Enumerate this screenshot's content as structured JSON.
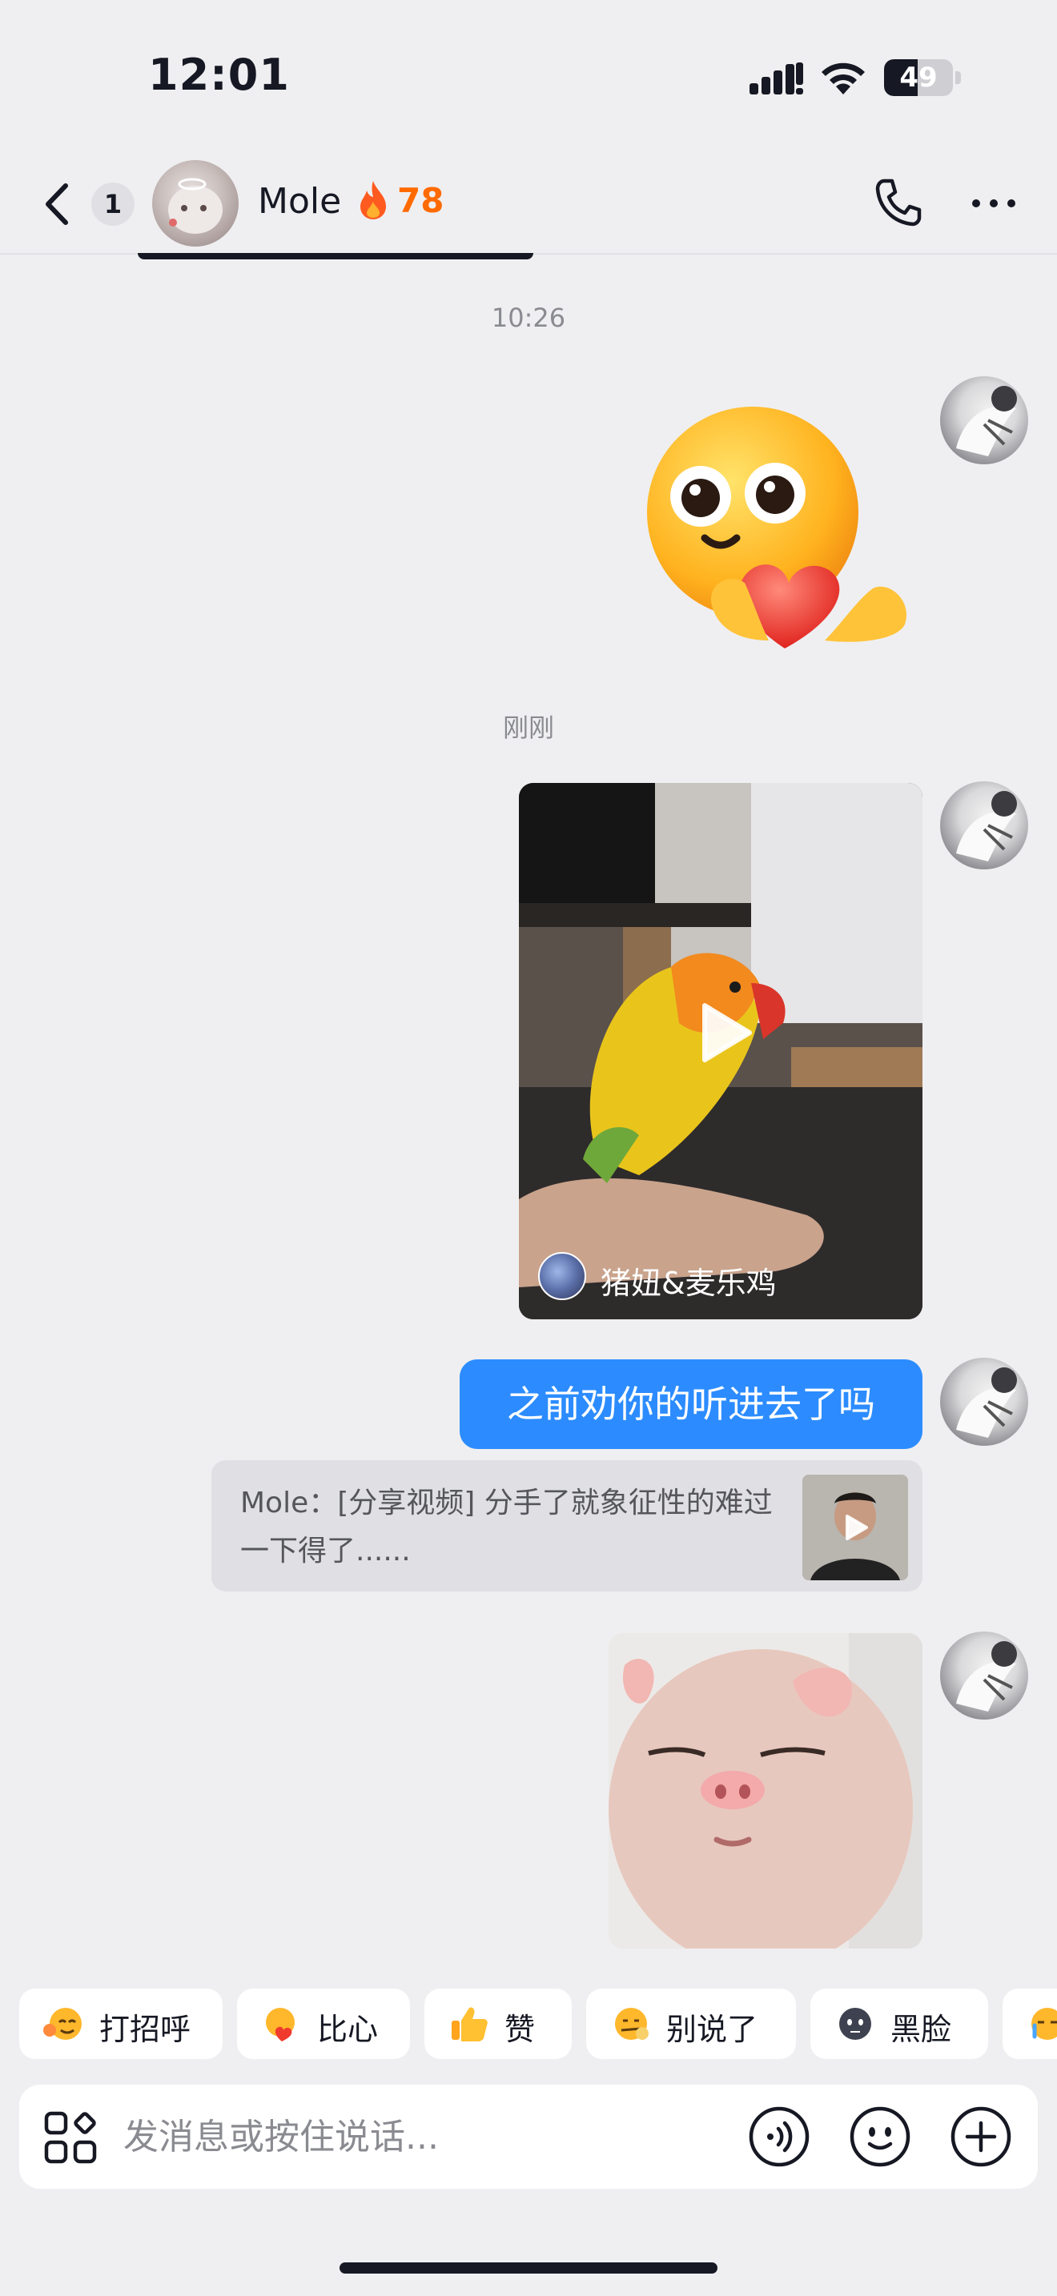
{
  "status_bar": {
    "time": "12:01",
    "battery_level": "49",
    "battery_fraction": 0.49,
    "icons": [
      "signal-icon",
      "wifi-icon",
      "battery-icon"
    ]
  },
  "header": {
    "unread_count": "1",
    "contact_name": "Mole",
    "streak_count": "78",
    "streak_color": "#FF6A00",
    "icons": [
      "back-arrow-icon",
      "fire-icon",
      "phone-icon",
      "more-icon"
    ]
  },
  "chat": {
    "timestamps": [
      "10:26",
      "刚刚"
    ],
    "video_share": {
      "author_name": "猪妞&麦乐鸡"
    },
    "text_message": "之前劝你的听进去了吗",
    "quote": {
      "text": "Mole：[分享视频] 分手了就象征性的难过一下得了......"
    }
  },
  "quick_replies": [
    {
      "label": "打招呼",
      "icon": "wave-face-icon"
    },
    {
      "label": "比心",
      "icon": "heart-hands-icon"
    },
    {
      "label": "赞",
      "icon": "thumbs-up-icon"
    },
    {
      "label": "别说了",
      "icon": "zipper-face-icon"
    },
    {
      "label": "黑脸",
      "icon": "dark-face-icon"
    }
  ],
  "input_bar": {
    "placeholder": "发消息或按住说话..."
  },
  "colors": {
    "background": "#EFEFF1",
    "sent_bubble": "#2C8CFF",
    "accent_streak": "#FF6A00"
  }
}
